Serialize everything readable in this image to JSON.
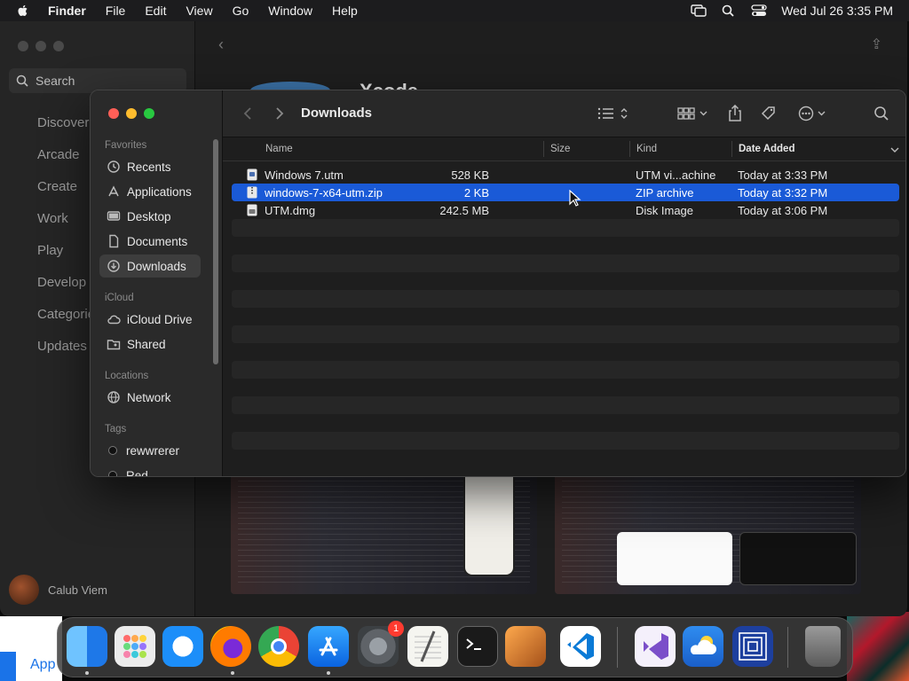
{
  "menubar": {
    "app_name": "Finder",
    "items": [
      "File",
      "Edit",
      "View",
      "Go",
      "Window",
      "Help"
    ],
    "clock": "Wed Jul 26  3:35 PM"
  },
  "appstore": {
    "search_placeholder": "Search",
    "nav": [
      "Discover",
      "Arcade",
      "Create",
      "Work",
      "Play",
      "Develop",
      "Categories",
      "Updates"
    ],
    "app_title": "Xcode",
    "user_name": "Calub Viem"
  },
  "finder": {
    "title": "Downloads",
    "sidebar": {
      "favorites_title": "Favorites",
      "favorites": [
        {
          "label": "Recents",
          "icon": "clock-icon"
        },
        {
          "label": "Applications",
          "icon": "applications-icon"
        },
        {
          "label": "Desktop",
          "icon": "desktop-icon"
        },
        {
          "label": "Documents",
          "icon": "document-icon"
        },
        {
          "label": "Downloads",
          "icon": "download-icon",
          "active": true
        }
      ],
      "icloud_title": "iCloud",
      "icloud": [
        {
          "label": "iCloud Drive",
          "icon": "cloud-icon"
        },
        {
          "label": "Shared",
          "icon": "shared-folder-icon"
        }
      ],
      "locations_title": "Locations",
      "locations": [
        {
          "label": "Network",
          "icon": "globe-icon"
        }
      ],
      "tags_title": "Tags",
      "tags": [
        {
          "label": "rewwrerer"
        },
        {
          "label": "Red"
        }
      ]
    },
    "columns": {
      "name": "Name",
      "size": "Size",
      "kind": "Kind",
      "date": "Date Added"
    },
    "files": [
      {
        "name": "Windows 7.utm",
        "size": "528 KB",
        "kind": "UTM vi...achine",
        "date": "Today at 3:33 PM"
      },
      {
        "name": "windows-7-x64-utm.zip",
        "size": "2 KB",
        "kind": "ZIP archive",
        "date": "Today at 3:32 PM",
        "selected": true
      },
      {
        "name": "UTM.dmg",
        "size": "242.5 MB",
        "kind": "Disk Image",
        "date": "Today at 3:06 PM"
      }
    ]
  },
  "wallpaper": {
    "left_label": "App"
  },
  "dock": {
    "apps": [
      "finder",
      "launchpad",
      "safari",
      "firefox",
      "chrome",
      "app-store",
      "system-settings",
      "textedit",
      "terminal",
      "garageband",
      "vscode",
      "visual-studio",
      "weather",
      "utm",
      "trash"
    ],
    "settings_badge": "1"
  }
}
